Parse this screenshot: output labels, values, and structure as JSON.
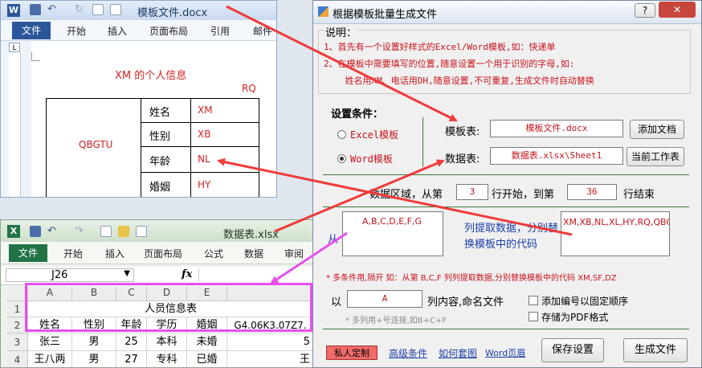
{
  "word": {
    "title": "模板文件.docx",
    "tabs": [
      "文件",
      "开始",
      "插入",
      "页面布局",
      "引用",
      "邮件"
    ],
    "ruler_mark": "L",
    "doc_title": "XM 的个人信息",
    "rq": "RQ",
    "photo_code": "QBGTU",
    "rows": [
      {
        "label": "姓名",
        "code": "XM"
      },
      {
        "label": "性别",
        "code": "XB"
      },
      {
        "label": "年龄",
        "code": "NL"
      },
      {
        "label": "婚姻",
        "code": "HY"
      }
    ]
  },
  "excel": {
    "title": "数据表.xlsx",
    "tabs": [
      "文件",
      "开始",
      "插入",
      "页面布局",
      "公式",
      "数据",
      "审阅"
    ],
    "name_box": "J26",
    "fx": "fx",
    "columns": [
      "A",
      "B",
      "C",
      "D",
      "E"
    ],
    "row_numbers": [
      "1",
      "2",
      "3",
      "4"
    ],
    "merged_title": "人员信息表",
    "headers": [
      "姓名",
      "性别",
      "年龄",
      "学历",
      "婚姻",
      "G4.06K3.07Z7."
    ],
    "rows": [
      [
        "张三",
        "男",
        "25",
        "本科",
        "未婚",
        "5"
      ],
      [
        "王八两",
        "男",
        "27",
        "专科",
        "已婚",
        "王"
      ]
    ]
  },
  "dialog": {
    "title": "根据模板批量生成文件",
    "help": "?",
    "close": "✕",
    "note_label": "说明：",
    "note_lines": [
      "1、首先有一个设置好样式的Excel/Word模板,如：快递单",
      "2、在模板中需要填写的位置,随意设置一个用于识别的字母,如:",
      "    姓名用XM、电话用DH,随意设置,不可重复,生成文件时自动替换"
    ],
    "settings_label": "设置条件：",
    "radio_excel": "Excel模板",
    "radio_word": "Word模板",
    "template_label": "模板表:",
    "template_value": "模板文件.docx",
    "add_doc_button": "添加文档",
    "data_label": "数据表:",
    "data_value": "数据表.xlsx\\Sheet1",
    "current_sheet_button": "当前工作表",
    "range_prefix": "数据区域，从第",
    "start_row": "3",
    "range_mid": "行开始，到第",
    "end_row": "36",
    "range_suffix": "行结束",
    "from_label": "从",
    "columns_value": "A,B,C,D,E,F,G",
    "extract_text": "列提取数据，分别替换模板中的代码",
    "codes_value": "XM,XB,NL,XL,HY,RQ,QBGTU",
    "multi_note": "* 多条件用,隔开 如：从第 B,C,F 列列提取数据,分别替换模板中的代码 XM,SF,DZ",
    "name_prefix": "以",
    "name_value": "A",
    "name_suffix": "列内容,命名文件",
    "name_hint": "* 多列用+号连接,如B+C+F",
    "check_add_number": "添加编号以固定顺序",
    "check_pdf": "存储为PDF格式",
    "custom_button": "私人定制",
    "link_advanced": "高级条件",
    "link_help": "如何套图",
    "link_word_page": "Word页眉",
    "save_button": "保存设置",
    "generate_button": "生成文件"
  },
  "colors": {
    "accent_red": "#d41f1f",
    "arrow_red": "#ef3b3b",
    "arrow_magenta": "#e84ef0",
    "word_blue": "#2b579a",
    "excel_green": "#217346"
  }
}
